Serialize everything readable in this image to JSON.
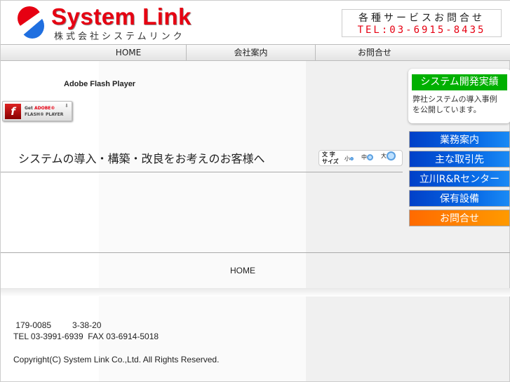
{
  "header": {
    "logo_title": "System Link",
    "logo_sub": "株式会社システムリンク",
    "contact_line1": "各種サービスお問合せ",
    "contact_line2": "TEL:03-6915-8435"
  },
  "nav": [
    {
      "label": "HOME"
    },
    {
      "label": "会社案内"
    },
    {
      "label": "お問合せ"
    }
  ],
  "flash": {
    "label": "Adobe Flash Player",
    "badge_get": "Get",
    "badge_adobe": "ADOBE®",
    "badge_flash": "FLASH® PLAYER"
  },
  "tagline": "システムの導入・構築・改良をお考えのお客様へ",
  "font_size": {
    "label1": "文 字",
    "label2": "サイズ",
    "small": "小",
    "medium": "中",
    "large": "大"
  },
  "card": {
    "title": "システム開発実績",
    "desc1": "弊社システムの導入事例",
    "desc2": "を公開しています。"
  },
  "side_menu": [
    {
      "label": "業務案内"
    },
    {
      "label": "主な取引先"
    },
    {
      "label": "立川R&Rセンター"
    },
    {
      "label": "保有設備"
    },
    {
      "label": "お問合せ"
    }
  ],
  "footer": {
    "home": "HOME",
    "address": " 179-0085         3-38-20",
    "tel": "TEL 03-3991-6939  FAX 03-6914-5018",
    "copyright": "Copyright(C) System Link Co.,Ltd. All Rights Reserved."
  }
}
